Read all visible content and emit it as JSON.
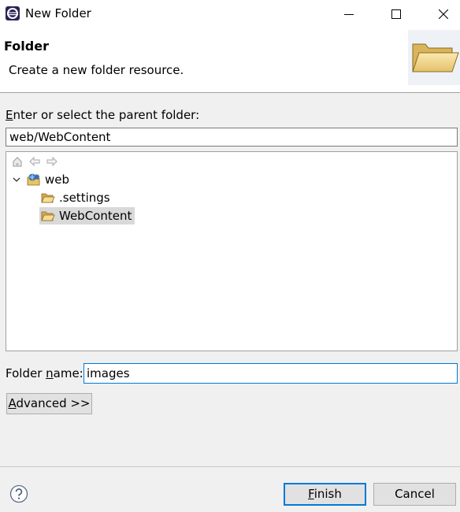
{
  "window": {
    "title": "New Folder"
  },
  "banner": {
    "title": "Folder",
    "description": "Create a new folder resource."
  },
  "parent": {
    "label_mnemonic": "E",
    "label_rest": "nter or select the parent folder:",
    "value": "web/WebContent"
  },
  "tree": {
    "items": [
      {
        "label": "web",
        "expanded": true,
        "icon": "project-icon"
      },
      {
        "label": ".settings",
        "icon": "folder-icon"
      },
      {
        "label": "WebContent",
        "icon": "folder-icon",
        "selected": true
      }
    ]
  },
  "folder_name": {
    "label_pre": "Folder ",
    "label_mnemonic": "n",
    "label_post": "ame:",
    "value": "images"
  },
  "buttons": {
    "advanced_mnemonic": "A",
    "advanced_rest": "dvanced >>",
    "finish_mnemonic": "F",
    "finish_rest": "inish",
    "cancel": "Cancel"
  },
  "colors": {
    "accent": "#0078d7",
    "selection": "#d9d9d9",
    "dialog_bg": "#f0f0f0"
  }
}
